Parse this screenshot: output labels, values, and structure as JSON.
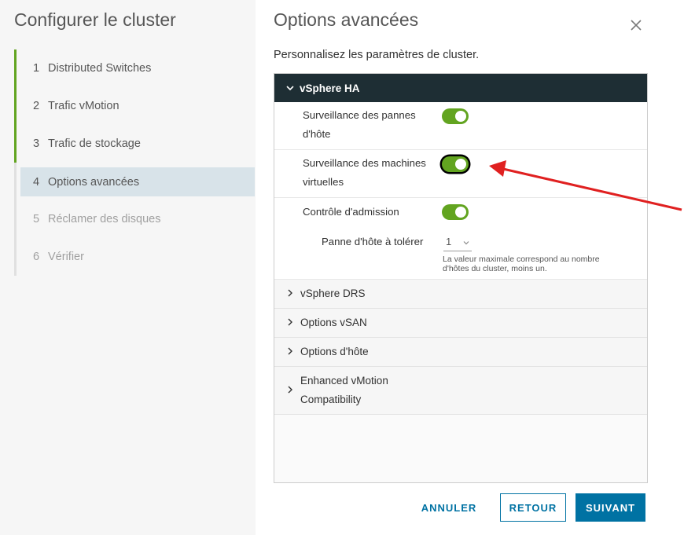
{
  "wizard": {
    "title": "Configurer le cluster",
    "steps": [
      {
        "num": "1",
        "label": "Distributed Switches",
        "state": "done"
      },
      {
        "num": "2",
        "label": "Trafic vMotion",
        "state": "done"
      },
      {
        "num": "3",
        "label": "Trafic de stockage",
        "state": "done"
      },
      {
        "num": "4",
        "label": "Options avancées",
        "state": "current"
      },
      {
        "num": "5",
        "label": "Réclamer des disques",
        "state": "future"
      },
      {
        "num": "6",
        "label": "Vérifier",
        "state": "future"
      }
    ]
  },
  "page": {
    "title": "Options avancées",
    "subtitle": "Personnalisez les paramètres de cluster."
  },
  "ha": {
    "header": "vSphere HA",
    "host_monitoring": {
      "label_line1": "Surveillance des pannes",
      "label_line2": "d'hôte",
      "on": true
    },
    "vm_monitoring": {
      "label_line1": "Surveillance des machines",
      "label_line2": "virtuelles",
      "on": true
    },
    "admission_control": {
      "label": "Contrôle d'admission",
      "on": true
    },
    "host_failures": {
      "label": "Panne d'hôte à tolérer",
      "value": "1",
      "hint_line1": "La valeur maximale correspond au nombre",
      "hint_line2": "d'hôtes du cluster, moins un."
    }
  },
  "sections": {
    "drs": "vSphere DRS",
    "vsan": "Options vSAN",
    "host": "Options d'hôte",
    "evc_line1": "Enhanced vMotion",
    "evc_line2": "Compatibility"
  },
  "buttons": {
    "cancel": "ANNULER",
    "back": "RETOUR",
    "next": "SUIVANT"
  },
  "colors": {
    "accent": "#0072a3",
    "toggle_on": "#62a420",
    "header_bg": "#1e2e34",
    "annotation_arrow": "#e02020"
  }
}
